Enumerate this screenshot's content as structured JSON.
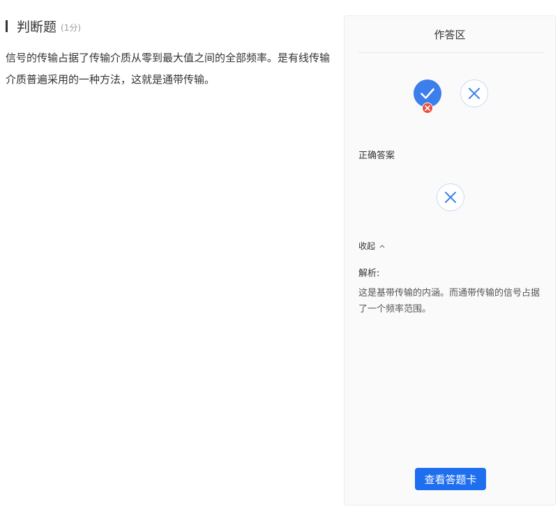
{
  "question": {
    "type_label": "判断题",
    "score": "(1分)",
    "text": "信号的传输占据了传输介质从零到最大值之间的全部频率。是有线传输介质普遍采用的一种方法，这就是通带传输。"
  },
  "answer_panel": {
    "title": "作答区",
    "options": [
      {
        "icon": "check-icon",
        "state": "selected-wrong"
      },
      {
        "icon": "cross-icon",
        "state": "unselected"
      }
    ],
    "correct_label": "正确答案",
    "correct_icon": "cross-icon",
    "collapse_label": "收起",
    "analysis_label": "解析:",
    "analysis_text": "这是基带传输的内涵。而通带传输的信号占据了一个频率范围。",
    "answer_card_button": "查看答题卡"
  },
  "colors": {
    "primary": "#1e6ff0",
    "selected": "#3d7fea",
    "wrong": "#e9503e"
  }
}
